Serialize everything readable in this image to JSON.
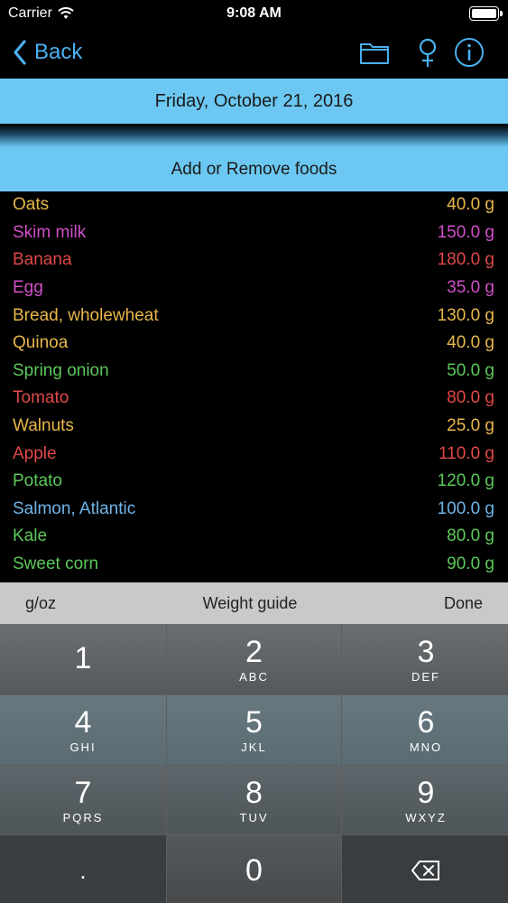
{
  "status_bar": {
    "carrier": "Carrier",
    "time": "9:08 AM"
  },
  "nav": {
    "back_label": "Back",
    "icons": [
      "folder-icon",
      "female-symbol-icon",
      "info-icon"
    ],
    "accent_color": "#4ab0f0"
  },
  "date_banner": "Friday, October 21, 2016",
  "add_remove_label": "Add or Remove foods",
  "foods": [
    {
      "name": "Oats",
      "amount": "40.0 g",
      "color": "#e8b64a"
    },
    {
      "name": "Skim milk",
      "amount": "150.0 g",
      "color": "#d04fc8"
    },
    {
      "name": "Banana",
      "amount": "180.0 g",
      "color": "#e04848"
    },
    {
      "name": "Egg",
      "amount": "35.0 g",
      "color": "#d04fc8"
    },
    {
      "name": "Bread, wholewheat",
      "amount": "130.0 g",
      "color": "#e8b64a"
    },
    {
      "name": "Quinoa",
      "amount": "40.0 g",
      "color": "#e8b64a"
    },
    {
      "name": "Spring onion",
      "amount": "50.0 g",
      "color": "#5cc85a"
    },
    {
      "name": "Tomato",
      "amount": "80.0 g",
      "color": "#e04848"
    },
    {
      "name": "Walnuts",
      "amount": "25.0 g",
      "color": "#e8b64a"
    },
    {
      "name": "Apple",
      "amount": "110.0 g",
      "color": "#e04848"
    },
    {
      "name": "Potato",
      "amount": "120.0 g",
      "color": "#5cc85a"
    },
    {
      "name": "Salmon, Atlantic",
      "amount": "100.0 g",
      "color": "#6fb4e8"
    },
    {
      "name": "Kale",
      "amount": "80.0 g",
      "color": "#5cc85a"
    },
    {
      "name": "Sweet corn",
      "amount": "90.0 g",
      "color": "#5cc85a"
    }
  ],
  "kb_toolbar": {
    "unit_toggle": "g/oz",
    "weight_guide": "Weight guide",
    "done": "Done"
  },
  "keypad": {
    "keys": [
      {
        "digit": "1",
        "letters": ""
      },
      {
        "digit": "2",
        "letters": "ABC"
      },
      {
        "digit": "3",
        "letters": "DEF"
      },
      {
        "digit": "4",
        "letters": "GHI"
      },
      {
        "digit": "5",
        "letters": "JKL"
      },
      {
        "digit": "6",
        "letters": "MNO"
      },
      {
        "digit": "7",
        "letters": "PQRS"
      },
      {
        "digit": "8",
        "letters": "TUV"
      },
      {
        "digit": "9",
        "letters": "WXYZ"
      },
      {
        "digit": ".",
        "letters": ""
      },
      {
        "digit": "0",
        "letters": ""
      }
    ],
    "delete_icon": "backspace-icon"
  }
}
